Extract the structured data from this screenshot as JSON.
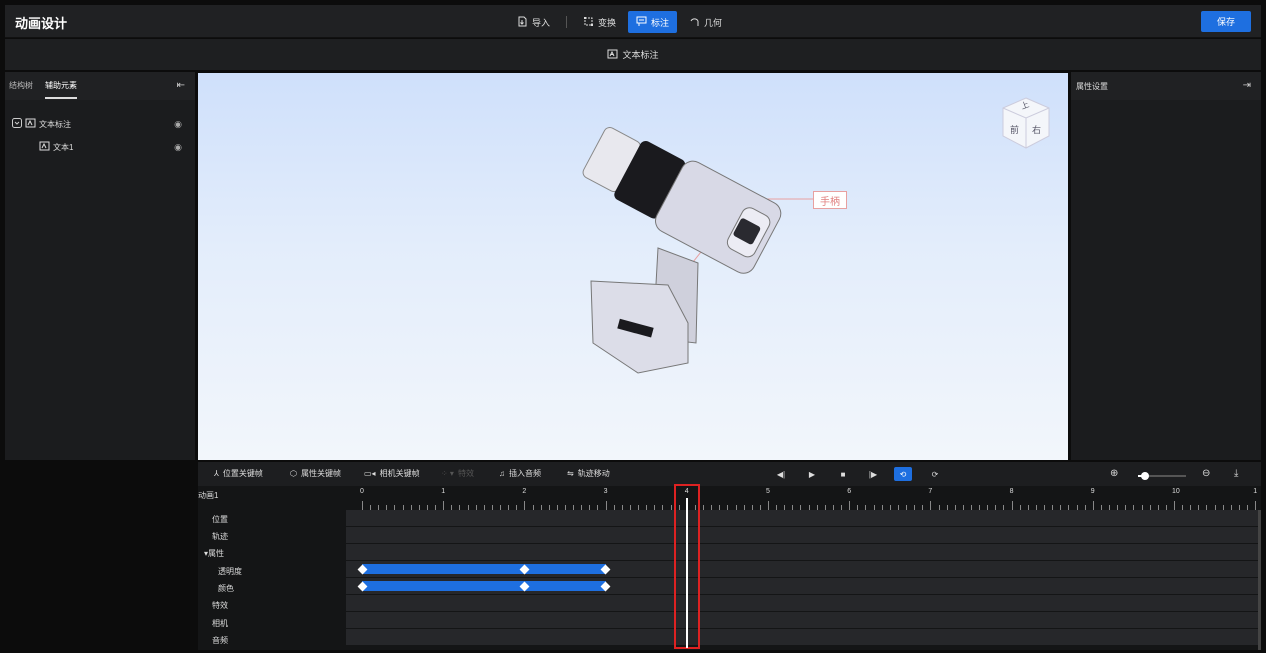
{
  "app": {
    "title": "动画设计",
    "save_label": "保存"
  },
  "toolbar": {
    "import": "导入",
    "transform": "变换",
    "annotate": "标注",
    "geometry": "几何"
  },
  "subbar": {
    "text_annotation": "文本标注"
  },
  "left_panel": {
    "tabs": [
      "结构树",
      "辅助元素"
    ],
    "tree": [
      {
        "label": "文本标注"
      },
      {
        "label": "文本1"
      }
    ]
  },
  "right_panel": {
    "title": "属性设置"
  },
  "viewport": {
    "callout": "手柄",
    "viewcube": {
      "top": "上",
      "front": "前",
      "right": "右"
    }
  },
  "timeline": {
    "toolbar": {
      "pos_key": "位置关键帧",
      "attr_key": "属性关键帧",
      "cam_key": "相机关键帧",
      "effect": "特效",
      "insert_audio": "插入音频",
      "track_move": "轨迹移动"
    },
    "animation_name": "动画1",
    "tracks": [
      "位置",
      "轨迹",
      "▾属性",
      "透明度",
      "颜色",
      "特效",
      "相机",
      "音频"
    ],
    "ruler": [
      "0",
      "1",
      "2",
      "3",
      "4",
      "5",
      "6",
      "7",
      "8",
      "9",
      "10",
      "1"
    ],
    "playhead_time": 4,
    "zoom_level": 0.15,
    "keyframes": {
      "opacity": [
        0,
        2,
        3
      ],
      "color": [
        0,
        2,
        3
      ]
    }
  }
}
